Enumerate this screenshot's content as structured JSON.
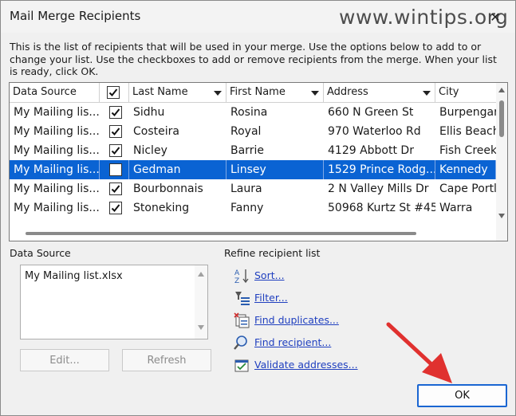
{
  "window": {
    "title": "Mail Merge Recipients",
    "close_glyph": "✕"
  },
  "watermark": "www.wintips.org",
  "intro": "This is the list of recipients that will be used in your merge.  Use the options below to add to or change your list.  Use the checkboxes to add or remove recipients from the merge.  When your list is ready, click OK.",
  "table": {
    "headers": {
      "data_source": "Data Source",
      "last_name": "Last Name",
      "first_name": "First Name",
      "address": "Address",
      "city": "City"
    },
    "rows": [
      {
        "source": "My Mailing lis...",
        "checked": true,
        "last": "Sidhu",
        "first": "Rosina",
        "address": "660 N Green St",
        "city": "Burpengar"
      },
      {
        "source": "My Mailing lis...",
        "checked": true,
        "last": "Costeira",
        "first": "Royal",
        "address": "970 Waterloo Rd",
        "city": "Ellis Beach"
      },
      {
        "source": "My Mailing lis...",
        "checked": true,
        "last": "Nicley",
        "first": "Barrie",
        "address": "4129 Abbott Dr",
        "city": "Fish Creek"
      },
      {
        "source": "My Mailing lis...",
        "checked": false,
        "last": "Gedman",
        "first": "Linsey",
        "address": "1529 Prince Rodg...",
        "city": "Kennedy",
        "selected": true
      },
      {
        "source": "My Mailing lis...",
        "checked": true,
        "last": "Bourbonnais",
        "first": "Laura",
        "address": "2 N Valley Mills Dr",
        "city": "Cape Portl"
      },
      {
        "source": "My Mailing lis...",
        "checked": true,
        "last": "Stoneking",
        "first": "Fanny",
        "address": "50968 Kurtz St #45",
        "city": "Warra"
      }
    ]
  },
  "data_source_panel": {
    "label": "Data Source",
    "items": [
      "My Mailing list.xlsx"
    ],
    "edit_label": "Edit...",
    "refresh_label": "Refresh"
  },
  "refine": {
    "label": "Refine recipient list",
    "links": [
      {
        "label": "Sort...",
        "icon": "sort-icon"
      },
      {
        "label": "Filter...",
        "icon": "filter-icon"
      },
      {
        "label": "Find duplicates...",
        "icon": "find-duplicates-icon"
      },
      {
        "label": "Find recipient...",
        "icon": "find-recipient-icon"
      },
      {
        "label": "Validate addresses...",
        "icon": "validate-addresses-icon"
      }
    ]
  },
  "ok_label": "OK",
  "colors": {
    "selection": "#0a63d3",
    "link": "#1f3fbf",
    "ok_border": "#1a66d2",
    "pointer": "#e0312f"
  }
}
